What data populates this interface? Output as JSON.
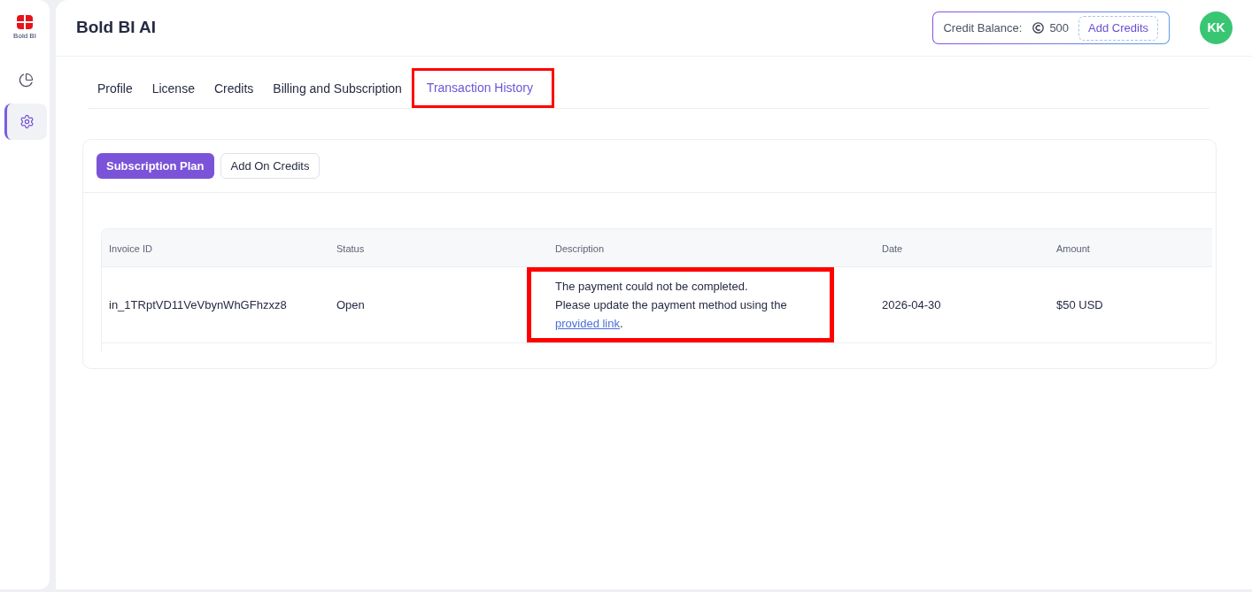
{
  "sidebar": {
    "logo_text": "Bold BI",
    "items": [
      {
        "kind": "pie",
        "selected": false
      },
      {
        "kind": "gear",
        "selected": true
      }
    ]
  },
  "header": {
    "title": "Bold BI AI",
    "credit_label": "Credit Balance:",
    "credit_value": "500",
    "add_credits": "Add Credits",
    "avatar": "KK"
  },
  "tabs": [
    {
      "label": "Profile",
      "selected": false,
      "highlighted": false
    },
    {
      "label": "License",
      "selected": false,
      "highlighted": false
    },
    {
      "label": "Credits",
      "selected": false,
      "highlighted": false
    },
    {
      "label": "Billing and Subscription",
      "selected": false,
      "highlighted": false
    },
    {
      "label": "Transaction History",
      "selected": true,
      "highlighted": true
    }
  ],
  "subtabs": [
    {
      "label": "Subscription Plan",
      "selected": true
    },
    {
      "label": "Add On Credits",
      "selected": false
    }
  ],
  "table": {
    "columns": [
      "Invoice ID",
      "Status",
      "Description",
      "Date",
      "Amount"
    ],
    "rows": [
      {
        "invoice_id": "in_1TRptVD11VeVbynWhGFhzxz8",
        "status": "Open",
        "description": {
          "lines": [
            "The payment could not be completed.",
            "Please update the payment method using the"
          ],
          "link": "provided link",
          "after": ".",
          "highlighted": true
        },
        "date": "2026-04-30",
        "amount": "$50 USD"
      }
    ]
  }
}
